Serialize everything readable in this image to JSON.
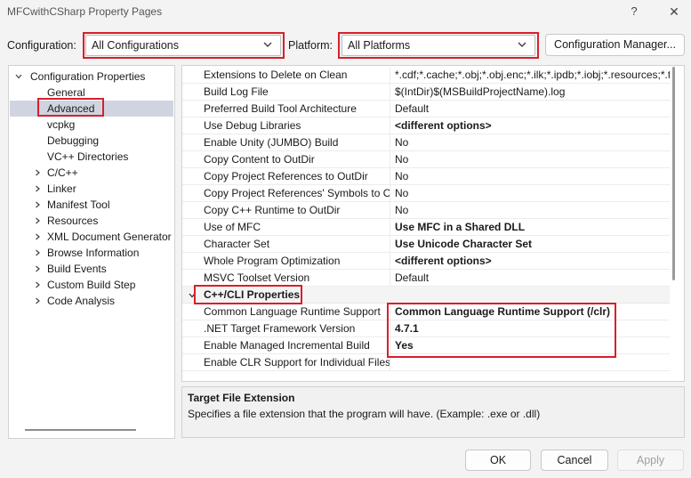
{
  "window": {
    "title": "MFCwithCSharp Property Pages",
    "help": "?",
    "close": "✕"
  },
  "toolbar": {
    "configuration_label": "Configuration:",
    "configuration_value": "All Configurations",
    "platform_label": "Platform:",
    "platform_value": "All Platforms",
    "config_manager": "Configuration Manager..."
  },
  "tree": {
    "root": "Configuration Properties",
    "items": [
      {
        "label": "General",
        "expandable": false,
        "selected": false
      },
      {
        "label": "Advanced",
        "expandable": false,
        "selected": true
      },
      {
        "label": "vcpkg",
        "expandable": false,
        "selected": false
      },
      {
        "label": "Debugging",
        "expandable": false,
        "selected": false
      },
      {
        "label": "VC++ Directories",
        "expandable": false,
        "selected": false
      },
      {
        "label": "C/C++",
        "expandable": true,
        "selected": false
      },
      {
        "label": "Linker",
        "expandable": true,
        "selected": false
      },
      {
        "label": "Manifest Tool",
        "expandable": true,
        "selected": false
      },
      {
        "label": "Resources",
        "expandable": true,
        "selected": false
      },
      {
        "label": "XML Document Generator",
        "expandable": true,
        "selected": false
      },
      {
        "label": "Browse Information",
        "expandable": true,
        "selected": false
      },
      {
        "label": "Build Events",
        "expandable": true,
        "selected": false
      },
      {
        "label": "Custom Build Step",
        "expandable": true,
        "selected": false
      },
      {
        "label": "Code Analysis",
        "expandable": true,
        "selected": false
      }
    ]
  },
  "grid": {
    "rows": [
      {
        "name": "Extensions to Delete on Clean",
        "value": "*.cdf;*.cache;*.obj;*.obj.enc;*.ilk;*.ipdb;*.iobj;*.resources;*.t",
        "bold": false
      },
      {
        "name": "Build Log File",
        "value": "$(IntDir)$(MSBuildProjectName).log",
        "bold": false
      },
      {
        "name": "Preferred Build Tool Architecture",
        "value": "Default",
        "bold": false
      },
      {
        "name": "Use Debug Libraries",
        "value": "<different options>",
        "bold": true
      },
      {
        "name": "Enable Unity (JUMBO) Build",
        "value": "No",
        "bold": false
      },
      {
        "name": "Copy Content to OutDir",
        "value": "No",
        "bold": false
      },
      {
        "name": "Copy Project References to OutDir",
        "value": "No",
        "bold": false
      },
      {
        "name": "Copy Project References' Symbols to Out",
        "value": "No",
        "bold": false
      },
      {
        "name": "Copy C++ Runtime to OutDir",
        "value": "No",
        "bold": false
      },
      {
        "name": "Use of MFC",
        "value": "Use MFC in a Shared DLL",
        "bold": true
      },
      {
        "name": "Character Set",
        "value": "Use Unicode Character Set",
        "bold": true
      },
      {
        "name": "Whole Program Optimization",
        "value": "<different options>",
        "bold": true
      },
      {
        "name": "MSVC Toolset Version",
        "value": "Default",
        "bold": false
      }
    ],
    "category": "C++/CLI Properties",
    "cli_rows": [
      {
        "name": "Common Language Runtime Support",
        "value": "Common Language Runtime Support (/clr)",
        "bold": true
      },
      {
        "name": ".NET Target Framework Version",
        "value": "4.7.1",
        "bold": true
      },
      {
        "name": "Enable Managed Incremental Build",
        "value": "Yes",
        "bold": true
      },
      {
        "name": "Enable CLR Support for Individual Files",
        "value": "",
        "bold": false
      }
    ]
  },
  "description": {
    "title": "Target File Extension",
    "text": "Specifies a file extension that the program will have. (Example: .exe or .dll)"
  },
  "buttons": {
    "ok": "OK",
    "cancel": "Cancel",
    "apply": "Apply"
  },
  "colors": {
    "highlight": "#d7202c",
    "selection": "#cfd4e0"
  }
}
